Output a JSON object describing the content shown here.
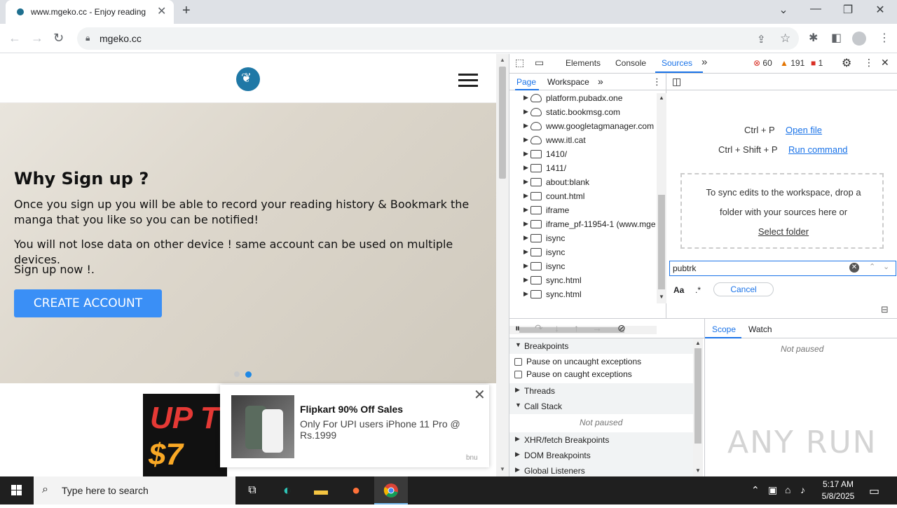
{
  "browser": {
    "tab_title": "www.mgeko.cc - Enjoy reading",
    "tab_close": "✕",
    "new_tab": "+",
    "url": "mgeko.cc",
    "window_controls": {
      "dropdown": "⌄",
      "minimize": "—",
      "restore": "❐",
      "close": "✕"
    }
  },
  "page": {
    "hero_title": "Why Sign up ?",
    "hero_p1": "Once you sign up you will be able to record your reading history & Bookmark the manga that you like so you can be notified!",
    "hero_p2": "You will not lose data on other device ! same account can be used on multiple devices.",
    "hero_p3": "Sign up now !.",
    "cta_label": "CREATE ACCOUNT",
    "carousel_active_index": 2,
    "banner_line1": "UP T",
    "banner_line2": "$7",
    "ad": {
      "title": "Flipkart 90% Off Sales",
      "description": "Only For UPI users iPhone 11 Pro @ Rs.1999",
      "tag": "bnu",
      "close": "✕"
    }
  },
  "devtools": {
    "tabs": [
      "Elements",
      "Console",
      "Sources"
    ],
    "more": "»",
    "errors": "60",
    "warnings": "191",
    "issues": "1",
    "nav_tabs": [
      "Page",
      "Workspace"
    ],
    "tree": [
      {
        "name": "platform.pubadx.one",
        "type": "cloud"
      },
      {
        "name": "static.bookmsg.com",
        "type": "cloud"
      },
      {
        "name": "www.googletagmanager.com",
        "type": "cloud"
      },
      {
        "name": "www.itl.cat",
        "type": "cloud"
      },
      {
        "name": "1410/",
        "type": "frame"
      },
      {
        "name": "1411/",
        "type": "frame"
      },
      {
        "name": "about:blank",
        "type": "frame"
      },
      {
        "name": "count.html",
        "type": "frame"
      },
      {
        "name": "iframe",
        "type": "frame"
      },
      {
        "name": "iframe_pf-11954-1 (www.mge",
        "type": "frame"
      },
      {
        "name": "isync",
        "type": "frame"
      },
      {
        "name": "isync",
        "type": "frame"
      },
      {
        "name": "isync",
        "type": "frame"
      },
      {
        "name": "sync.html",
        "type": "frame"
      },
      {
        "name": "sync.html",
        "type": "frame"
      }
    ],
    "shortcuts": [
      {
        "keys": "Ctrl + P",
        "action": "Open file"
      },
      {
        "keys": "Ctrl + Shift + P",
        "action": "Run command"
      }
    ],
    "dropzone": {
      "line1": "To sync edits to the workspace, drop a",
      "line2": "folder with your sources here or",
      "link": "Select folder"
    },
    "search_value": "pubtrk",
    "match_case": "Aa",
    "regex": ".*",
    "cancel": "Cancel",
    "debugger": {
      "breakpoints": "Breakpoints",
      "pause_uncaught": "Pause on uncaught exceptions",
      "pause_caught": "Pause on caught exceptions",
      "threads": "Threads",
      "call_stack": "Call Stack",
      "not_paused": "Not paused",
      "xhr": "XHR/fetch Breakpoints",
      "dom": "DOM Breakpoints",
      "global": "Global Listeners",
      "scope_tab": "Scope",
      "watch_tab": "Watch"
    }
  },
  "watermark": "ANY RUN",
  "taskbar": {
    "search_placeholder": "Type here to search",
    "time": "5:17 AM",
    "date": "5/8/2025"
  }
}
